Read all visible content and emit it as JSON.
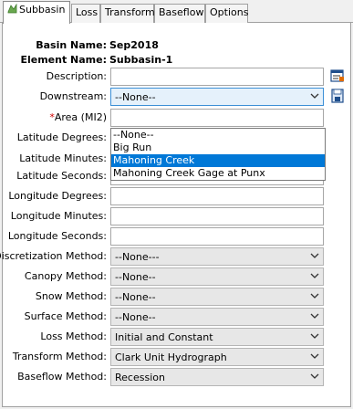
{
  "tabs": [
    {
      "label": "Subbasin",
      "active": true
    },
    {
      "label": "Loss",
      "active": false
    },
    {
      "label": "Transform",
      "active": false
    },
    {
      "label": "Baseflow",
      "active": false
    },
    {
      "label": "Options",
      "active": false
    }
  ],
  "basin": {
    "label": "Basin Name:",
    "value": "Sep2018"
  },
  "element": {
    "label": "Element Name:",
    "value": "Subbasin-1"
  },
  "description": {
    "label": "Description:",
    "value": ""
  },
  "downstream": {
    "label": "Downstream:",
    "value": "--None--",
    "options": [
      "--None--",
      "Big Run",
      "Mahoning Creek",
      "Mahoning Creek Gage at Punx"
    ],
    "highlighted": "Mahoning Creek"
  },
  "area": {
    "required_mark": "*",
    "label": "Area (MI2)"
  },
  "latitude_degrees": {
    "label": "Latitude Degrees:"
  },
  "latitude_minutes": {
    "label": "Latitude Minutes:"
  },
  "latitude_seconds": {
    "label": "Latitude Seconds:"
  },
  "longitude_degrees": {
    "label": "Longitude Degrees:"
  },
  "longitude_minutes": {
    "label": "Longitude Minutes:"
  },
  "longitude_seconds": {
    "label": "Longitude Seconds:"
  },
  "discretization": {
    "label": "Discretization Method:",
    "value": "--None---"
  },
  "canopy": {
    "label": "Canopy Method:",
    "value": "--None--"
  },
  "snow": {
    "label": "Snow Method:",
    "value": "--None--"
  },
  "surface": {
    "label": "Surface Method:",
    "value": "--None--"
  },
  "loss": {
    "label": "Loss Method:",
    "value": "Initial and Constant"
  },
  "transform": {
    "label": "Transform Method:",
    "value": "Clark Unit Hydrograph"
  },
  "baseflow": {
    "label": "Baseflow Method:",
    "value": "Recession"
  },
  "colors": {
    "selection": "#0078d7",
    "required": "#d00000",
    "open_select_bg": "#e5f1fb"
  },
  "icons": {
    "tab_subbasin": "subbasin-icon",
    "description": "description-editor-icon",
    "downstream": "downstream-selector-icon",
    "dropdown": "chevron-down-icon"
  }
}
